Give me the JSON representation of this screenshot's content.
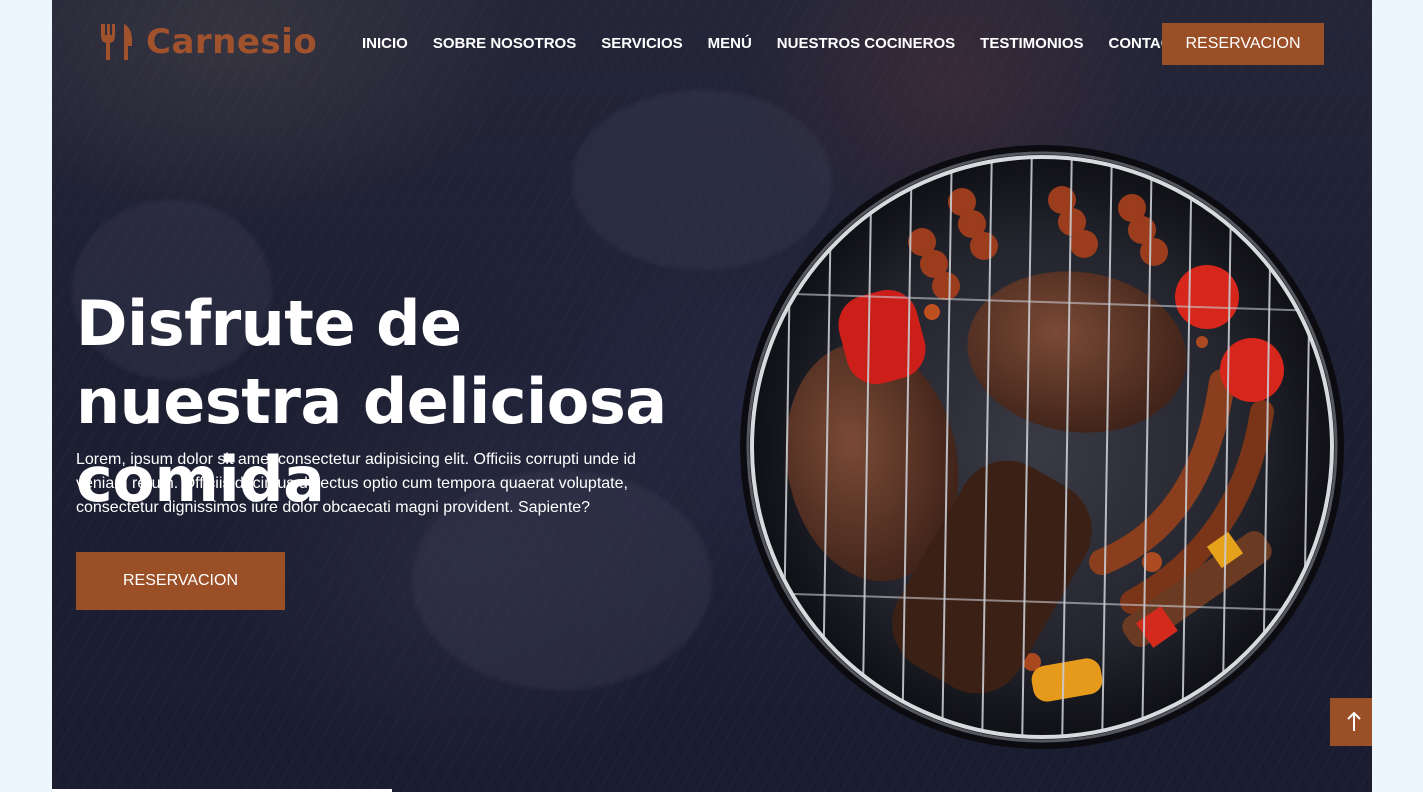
{
  "brand": {
    "name": "Carnesio",
    "icon": "utensils-icon",
    "color": "#a0522d"
  },
  "nav": {
    "items": [
      {
        "label": "INICIO"
      },
      {
        "label": "SOBRE NOSOTROS"
      },
      {
        "label": "SERVICIOS"
      },
      {
        "label": "MENÚ"
      },
      {
        "label": "NUESTROS COCINEROS"
      },
      {
        "label": "TESTIMONIOS"
      },
      {
        "label": "CONTACTO"
      }
    ],
    "cta_label": "RESERVACION"
  },
  "hero": {
    "title": "Disfrute de nuestra deliciosa comida",
    "text": "Lorem, ipsum dolor sit amet consectetur adipisicing elit. Officiis corrupti unde id veniam rerum. Officiis ducimus delectus optio cum tempora quaerat voluptate, consectetur dignissimos iure dolor obcaecati magni provident. Sapiente?",
    "cta_label": "RESERVACION",
    "image": "bbq-grill-image"
  },
  "scroll_top": {
    "icon": "arrow-up-icon"
  },
  "colors": {
    "accent": "#9b4f27",
    "background": "#1d1f33",
    "page_margin": "#eef6fd"
  }
}
